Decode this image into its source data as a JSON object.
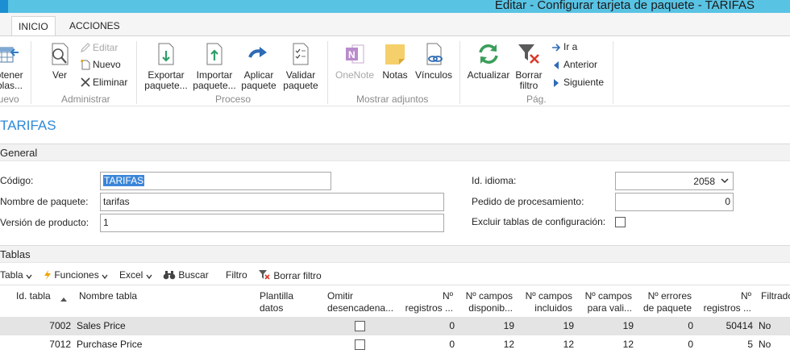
{
  "window": {
    "title": "Editar - Configurar tarjeta de paquete - TARIFAS"
  },
  "tabs": [
    {
      "label": "INICIO",
      "active": true
    },
    {
      "label": "ACCIONES",
      "active": false
    }
  ],
  "ribbon": {
    "groups": {
      "nuevo": {
        "label": "Nuevo",
        "buttons": {
          "obtener": {
            "label_l1": "Obtener",
            "label_l2": "tablas..."
          }
        }
      },
      "administrar": {
        "label": "Administrar",
        "ver": "Ver",
        "editar": "Editar",
        "nuevo": "Nuevo",
        "eliminar": "Eliminar"
      },
      "proceso": {
        "label": "Proceso",
        "exportar": {
          "l1": "Exportar",
          "l2": "paquete..."
        },
        "importar": {
          "l1": "Importar",
          "l2": "paquete..."
        },
        "aplicar": {
          "l1": "Aplicar",
          "l2": "paquete"
        },
        "validar": {
          "l1": "Validar",
          "l2": "paquete"
        }
      },
      "adjuntos": {
        "label": "Mostrar adjuntos",
        "onenote": "OneNote",
        "notas": "Notas",
        "vinculos": "Vínculos"
      },
      "pag": {
        "label": "Pág.",
        "actualizar": "Actualizar",
        "borrar_filtro": {
          "l1": "Borrar",
          "l2": "filtro"
        },
        "ir_a": "Ir a",
        "anterior": "Anterior",
        "siguiente": "Siguiente"
      }
    }
  },
  "page_title": "TARIFAS",
  "general": {
    "section_label": "General",
    "codigo": {
      "label": "Código:",
      "value": "TARIFAS"
    },
    "nombre": {
      "label": "Nombre de paquete:",
      "value": "tarifas"
    },
    "version": {
      "label": "Versión de producto:",
      "value": "1"
    },
    "idioma": {
      "label": "Id. idioma:",
      "value": "2058"
    },
    "pedido": {
      "label": "Pedido de procesamiento:",
      "value": "0"
    },
    "excluir": {
      "label": "Excluir tablas de configuración:",
      "checked": false
    }
  },
  "tablas": {
    "section_label": "Tablas",
    "toolbar": {
      "tabla": "Tabla",
      "funciones": "Funciones",
      "excel": "Excel",
      "buscar": "Buscar",
      "filtro": "Filtro",
      "borrar_filtro": "Borrar filtro"
    },
    "columns": {
      "id": "Id. tabla",
      "nombre": "Nombre tabla",
      "plantilla_l1": "Plantilla",
      "plantilla_l2": "datos",
      "omitir_l1": "Omitir",
      "omitir_l2": "desencadena...",
      "nreg_l1": "Nº",
      "nreg_l2": "registros ...",
      "disp_l1": "Nº campos",
      "disp_l2": "disponib...",
      "incl_l1": "Nº campos",
      "incl_l2": "incluidos",
      "vali_l1": "Nº campos",
      "vali_l2": "para vali...",
      "err_l1": "Nº errores",
      "err_l2": "de paquete",
      "nreg2_l1": "Nº",
      "nreg2_l2": "registros ...",
      "filtrado": "Filtrado"
    },
    "rows": [
      {
        "id": "7002",
        "nombre": "Sales Price",
        "omitir": false,
        "nreg": "0",
        "disp": "19",
        "incl": "19",
        "vali": "19",
        "err": "0",
        "nreg2": "50414",
        "filtrado": "No",
        "selected": true
      },
      {
        "id": "7012",
        "nombre": "Purchase Price",
        "omitir": false,
        "nreg": "0",
        "disp": "12",
        "incl": "12",
        "vali": "12",
        "err": "0",
        "nreg2": "5",
        "filtrado": "No",
        "selected": false
      }
    ]
  },
  "colors": {
    "accent": "#2e8ad8",
    "titlebar": "#59c3e4",
    "selection": "#3a86d8"
  }
}
